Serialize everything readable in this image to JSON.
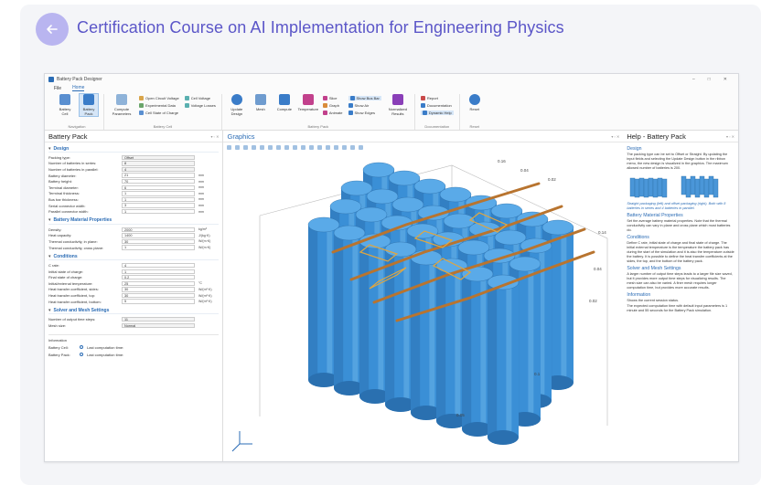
{
  "course": {
    "title": "Certification Course on AI Implementation for Engineering Physics",
    "back_icon": "arrow-left-icon",
    "accent": "#5b56c8"
  },
  "app": {
    "window_title": "Battery Pack Designer",
    "menu": [
      "File",
      "Home"
    ],
    "ribbon": {
      "navigation": {
        "label": "Navigation",
        "buttons": [
          "Battery Cell",
          "Battery Pack"
        ]
      },
      "battery_cell": {
        "label": "Battery Cell",
        "compute_params": "Compute Parameters",
        "items": [
          "Open Circuit Voltage",
          "Experimental Data",
          "Cell State of Charge",
          "Cell Voltage",
          "Voltage Losses"
        ]
      },
      "battery_pack": {
        "label": "Battery Pack",
        "buttons": [
          "Update Design",
          "Mesh",
          "Compute",
          "Temperature"
        ],
        "items": [
          "Slice",
          "Graph",
          "Animate",
          "Show Bus Bar",
          "Show Air",
          "Show Edges"
        ],
        "normalized": "Normalized Results"
      },
      "documentation": {
        "label": "Documentation",
        "items": [
          "Report",
          "Documentation",
          "Dynamic Help"
        ]
      },
      "reset": {
        "label": "Reset",
        "button": "Reset"
      }
    },
    "left_panel": {
      "title": "Battery Pack",
      "design": {
        "heading": "Design",
        "rows": [
          {
            "label": "Packing type:",
            "value": "Offset",
            "unit": ""
          },
          {
            "label": "Number of batteries in series:",
            "value": "8",
            "unit": ""
          },
          {
            "label": "Number of batteries in parallel:",
            "value": "4",
            "unit": ""
          },
          {
            "label": "Battery diameter:",
            "value": "21",
            "unit": "mm"
          },
          {
            "label": "Battery height:",
            "value": "70",
            "unit": "mm"
          },
          {
            "label": "Terminal diameter:",
            "value": "6",
            "unit": "mm"
          },
          {
            "label": "Terminal thickness:",
            "value": "1",
            "unit": "mm"
          },
          {
            "label": "Bus bar thickness:",
            "value": "1",
            "unit": "mm"
          },
          {
            "label": "Serial connector width:",
            "value": "3",
            "unit": "mm"
          },
          {
            "label": "Parallel connector width:",
            "value": "1",
            "unit": "mm"
          }
        ]
      },
      "material": {
        "heading": "Battery Material Properties",
        "rows": [
          {
            "label": "Density:",
            "value": "2000",
            "unit": "kg/m³"
          },
          {
            "label": "Heat capacity:",
            "value": "1400",
            "unit": "J/(kg·K)"
          },
          {
            "label": "Thermal conductivity, in plane:",
            "value": "30",
            "unit": "W/(m·K)"
          },
          {
            "label": "Thermal conductivity, cross plane:",
            "value": "1",
            "unit": "W/(m·K)"
          }
        ]
      },
      "conditions": {
        "heading": "Conditions",
        "rows": [
          {
            "label": "C rate:",
            "value": "4",
            "unit": ""
          },
          {
            "label": "Initial state of charge:",
            "value": "1",
            "unit": ""
          },
          {
            "label": "Final state of charge:",
            "value": "0.2",
            "unit": ""
          },
          {
            "label": "Initial/external temperature:",
            "value": "25",
            "unit": "°C"
          },
          {
            "label": "Heat transfer coefficient, sides:",
            "value": "30",
            "unit": "W/(m²·K)"
          },
          {
            "label": "Heat transfer coefficient, top:",
            "value": "30",
            "unit": "W/(m²·K)"
          },
          {
            "label": "Heat transfer coefficient, bottom:",
            "value": "5",
            "unit": "W/(m²·K)"
          }
        ]
      },
      "solver": {
        "heading": "Solver and Mesh Settings",
        "rows": [
          {
            "label": "Number of output time steps:",
            "value": "11",
            "unit": ""
          },
          {
            "label": "Mesh size:",
            "value": "Normal",
            "unit": ""
          }
        ]
      },
      "info": {
        "heading": "Information",
        "rows": [
          {
            "label": "Battery Cell:",
            "status": "Last computation time:"
          },
          {
            "label": "Battery Pack:",
            "status": "Last computation time:"
          }
        ]
      }
    },
    "graphics": {
      "title": "Graphics",
      "axis_labels": [
        "0.16",
        "0.04",
        "0.02",
        "0.14",
        "0.04",
        "0.02",
        "0.1",
        "0.05"
      ],
      "cell_color": "#3a8fd6",
      "busbar_color": "#b8742f"
    },
    "help": {
      "title": "Help - Battery Pack",
      "sections": [
        {
          "heading": "Design",
          "text": "The packing type can be set to Offset or Straight. By updating the input fields and selecting the Update Design button in the ribbon menu, the new design is visualized in the graphics. The maximum allowed number of batteries is 200."
        },
        {
          "heading": "",
          "text": "Straight packaging (left) and offset packaging (right). Both with 8 batteries in series and 4 batteries in parallel."
        },
        {
          "heading": "Battery Material Properties",
          "text": "Set the average battery material properties. Note that the thermal conductivity can vary in plane and cross plane which most batteries do."
        },
        {
          "heading": "Conditions",
          "text": "Define C rate, initial state of charge and final state of charge. The initial external temperature is the temperature the battery pack has during the start of the simulation and it is also the temperature outside the battery. It is possible to define the heat transfer coefficients at the sides, the top, and the bottom of the battery pack."
        },
        {
          "heading": "Solver and Mesh Settings",
          "text": "A larger number of output time steps leads to a larger file size saved, but it provides more output time steps for visualizing results. The mesh size can also be varied. A finer mesh requires longer computation time, but provides more accurate results."
        },
        {
          "heading": "Information",
          "text": "Shows the current session status."
        },
        {
          "heading": "",
          "text": "The expected computation time with default input parameters is 1 minute and 55 seconds for the Battery Pack simulation."
        }
      ]
    }
  }
}
